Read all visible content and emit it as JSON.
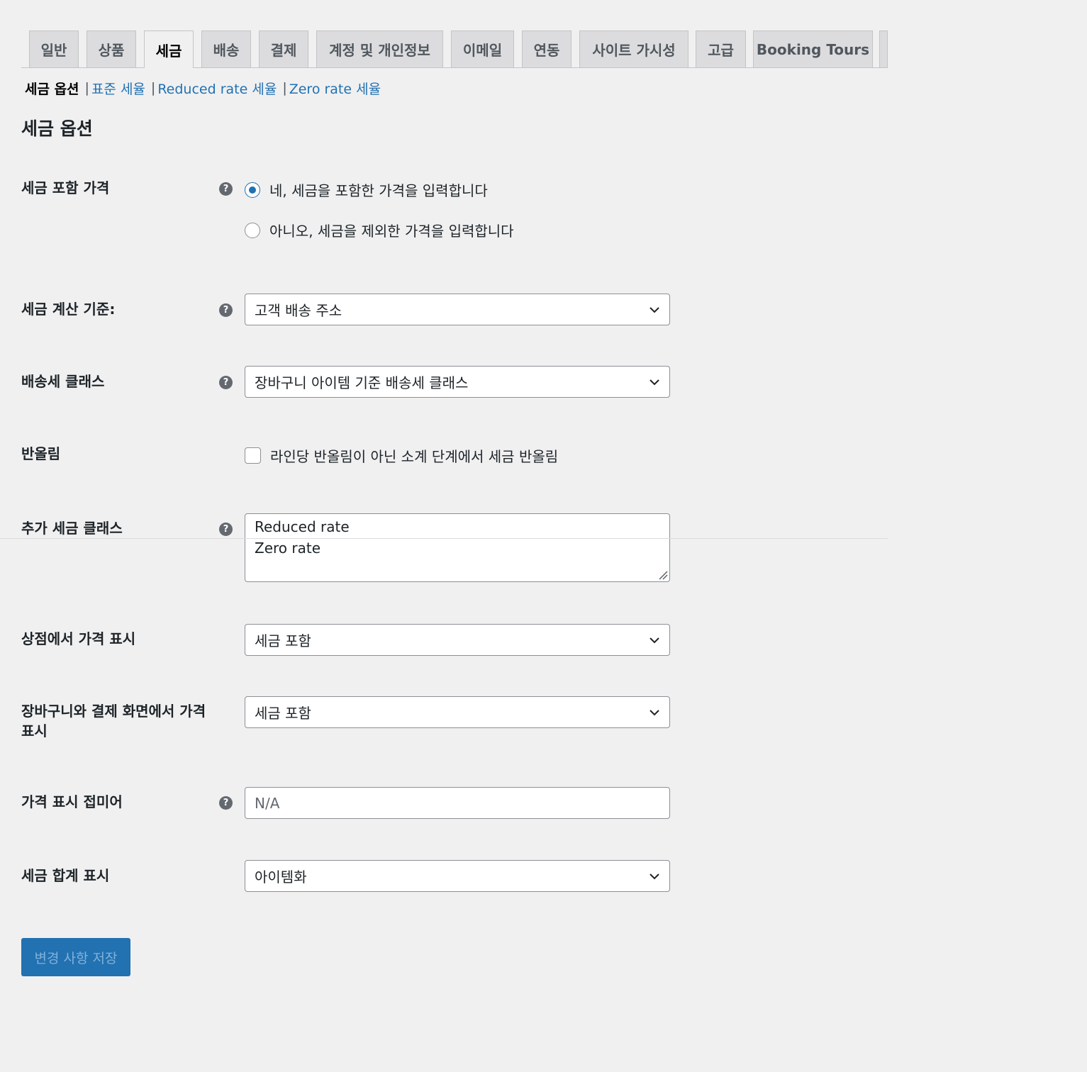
{
  "tabs": [
    "일반",
    "상품",
    "세금",
    "배송",
    "결제",
    "계정 및 개인정보",
    "이메일",
    "연동",
    "사이트 가시성",
    "고급",
    "Booking Tours"
  ],
  "active_tab": "세금",
  "subnav": {
    "current": "세금 옵션",
    "links": [
      "표준 세율",
      "Reduced rate 세율",
      "Zero rate 세율"
    ]
  },
  "section_title": "세금 옵션",
  "fields": {
    "prices_include_tax": {
      "label": "세금 포함 가격",
      "options": [
        "네, 세금을 포함한 가격을 입력합니다",
        "아니오, 세금을 제외한 가격을 입력합니다"
      ],
      "selected": 0
    },
    "tax_based_on": {
      "label": "세금 계산 기준:",
      "value": "고객 배송 주소"
    },
    "shipping_tax_class": {
      "label": "배송세 클래스",
      "value": "장바구니 아이템 기준 배송세 클래스"
    },
    "rounding": {
      "label": "반올림",
      "checkbox_label": "라인당 반올림이 아닌 소계 단계에서 세금 반올림",
      "checked": false
    },
    "additional_tax_classes": {
      "label": "추가 세금 클래스",
      "lines": [
        "Reduced rate",
        "Zero rate"
      ]
    },
    "display_prices_shop": {
      "label": "상점에서 가격 표시",
      "value": "세금 포함"
    },
    "display_prices_cart": {
      "label": "장바구니와 결제 화면에서 가격 표시",
      "value": "세금 포함"
    },
    "price_display_suffix": {
      "label": "가격 표시 접미어",
      "placeholder": "N/A"
    },
    "display_tax_totals": {
      "label": "세금 합계 표시",
      "value": "아이템화"
    }
  },
  "save_button": "변경 사항 저장",
  "colors": {
    "accent": "#2271b1",
    "background": "#f0f0f1"
  },
  "icons": {
    "help": "help-icon",
    "select": "chevron-down-icon"
  }
}
